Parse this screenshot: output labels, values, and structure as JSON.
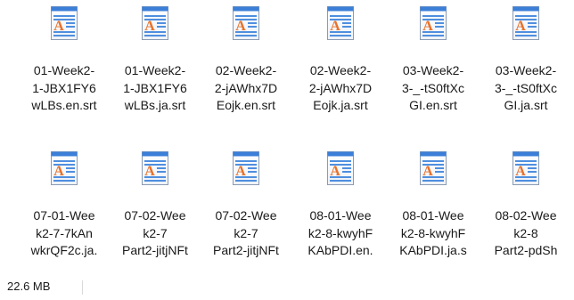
{
  "files": [
    {
      "name": "01-Week2-\n1-JBX1FY6\nwLBs.en.srt",
      "icon": "wordpad-document-icon"
    },
    {
      "name": "01-Week2-\n1-JBX1FY6\nwLBs.ja.srt",
      "icon": "wordpad-document-icon"
    },
    {
      "name": "02-Week2-\n2-jAWhx7D\nEojk.en.srt",
      "icon": "wordpad-document-icon"
    },
    {
      "name": "02-Week2-\n2-jAWhx7D\nEojk.ja.srt",
      "icon": "wordpad-document-icon"
    },
    {
      "name": "03-Week2-\n3-_-tS0ftXc\nGI.en.srt",
      "icon": "wordpad-document-icon"
    },
    {
      "name": "03-Week2-\n3-_-tS0ftXc\nGI.ja.srt",
      "icon": "wordpad-document-icon"
    },
    {
      "name": "07-01-Wee\nk2-7-7kAn\nwkrQF2c.ja.",
      "icon": "wordpad-document-icon"
    },
    {
      "name": "07-02-Wee\nk2-7\nPart2-jitjNFt",
      "icon": "wordpad-document-icon"
    },
    {
      "name": "07-02-Wee\nk2-7\nPart2-jitjNFt",
      "icon": "wordpad-document-icon"
    },
    {
      "name": "08-01-Wee\nk2-8-kwyhF\nKAbPDI.en.",
      "icon": "wordpad-document-icon"
    },
    {
      "name": "08-01-Wee\nk2-8-kwyhF\nKAbPDI.ja.s",
      "icon": "wordpad-document-icon"
    },
    {
      "name": "08-02-Wee\nk2-8\nPart2-pdSh",
      "icon": "wordpad-document-icon"
    }
  ],
  "status": {
    "total_size": "22.6 MB"
  },
  "colors": {
    "icon_blue": "#2f74d0",
    "icon_orange": "#e8712a",
    "page_bg": "#ffffff"
  }
}
